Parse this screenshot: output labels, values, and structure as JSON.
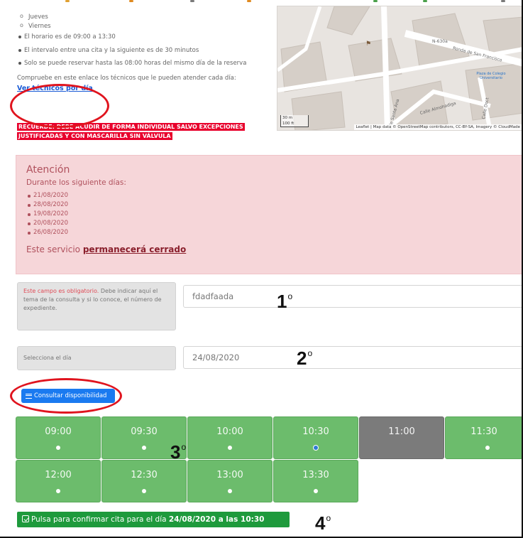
{
  "schedule": {
    "days": [
      "Jueves",
      "Viernes"
    ],
    "rules": [
      "El horario es de 09:00 a 13:30",
      "El intervalo entre una cita y la siguiente es de 30 minutos",
      "Solo se puede reservar hasta las 08:00 horas del mismo día de la reserva"
    ],
    "check_text": "Compruebe en este enlace los técnicos que le pueden atender cada día:",
    "tech_link": "Ver técnicos por día",
    "warning": "RECUERDE: DEBE ACUDIR DE FORMA INDIVIDUAL SALVO EXCEPCIONES JUSTIFICADAS Y CON MASCARILLA SIN VÁLVULA"
  },
  "map": {
    "labels": [
      "N-630a",
      "Ronda de San Francisco",
      "Calle Santa Ana",
      "Calle Almohadiga",
      "Calle Doct",
      "Plaza de Colegio Universitario"
    ],
    "attribution": "Leaflet | Map data © OpenStreetMap contributors, CC-BY-SA, Imagery © CloudMade",
    "scale": [
      "30 m",
      "100 ft"
    ]
  },
  "alert": {
    "title": "Atención",
    "subtitle": "Durante los siguiente días:",
    "dates": [
      "21/08/2020",
      "28/08/2020",
      "19/08/2020",
      "20/08/2020",
      "26/08/2020"
    ],
    "closed_prefix": "Este servicio",
    "closed_bold": "permanecerá cerrado"
  },
  "form": {
    "topic_required": "Este campo es obligatorio.",
    "topic_help": "Debe indicar aquí el tema de la consulta y si lo conoce, el número de expediente.",
    "topic_value": "fdadfaada",
    "day_label": "Selecciona el día",
    "day_value": "24/08/2020",
    "consult_button": "Consultar disponibilidad"
  },
  "slots": [
    {
      "time": "09:00",
      "state": "available"
    },
    {
      "time": "09:30",
      "state": "available"
    },
    {
      "time": "10:00",
      "state": "available"
    },
    {
      "time": "10:30",
      "state": "selected"
    },
    {
      "time": "11:00",
      "state": "busy"
    },
    {
      "time": "11:30",
      "state": "available"
    },
    {
      "time": "12:00",
      "state": "available"
    },
    {
      "time": "12:30",
      "state": "available"
    },
    {
      "time": "13:00",
      "state": "available"
    },
    {
      "time": "13:30",
      "state": "available"
    }
  ],
  "confirm": {
    "prefix": "Pulsa para confirmar cita para el día",
    "bold": "24/08/2020 a las 10:30"
  },
  "annotations": {
    "steps": [
      "1",
      "2",
      "3",
      "4"
    ],
    "degree": "o",
    "ring_color": "#e0141e"
  },
  "colors": {
    "slot_available": "#6cbc6c",
    "slot_busy": "#7b7b7b",
    "confirm": "#1e9a3c",
    "consult": "#1a7af0",
    "warning": "#e8002c",
    "alert_bg": "#f6d6d9"
  }
}
